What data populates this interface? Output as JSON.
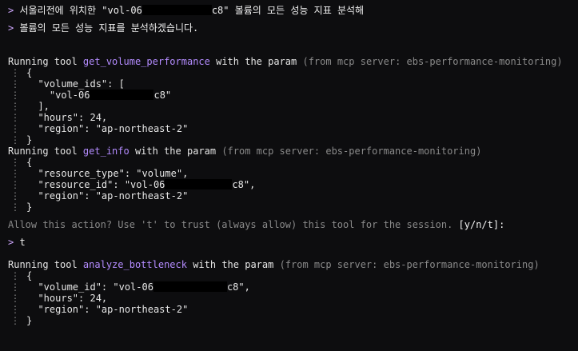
{
  "prompt_symbol": ">",
  "user_query": {
    "prefix": "서울리전에 위치한 \"vol-06",
    "suffix": "c8\" 볼륨의 모든 성능 지표 분석해"
  },
  "assistant_reply": "볼륨의 모든 성능 지표를 분석하겠습니다.",
  "running_prefix": "Running tool ",
  "param_word": " with the param ",
  "server_note": "(from mcp server: ebs-performance-monitoring)",
  "brace_open": "{",
  "brace_close": "}",
  "tool1": {
    "name": "get_volume_performance",
    "lines": {
      "volume_ids_open": "\"volume_ids\": [",
      "volume_id_prefix": "\"vol-06",
      "volume_id_suffix": "c8\"",
      "array_close": "],",
      "hours": "\"hours\": 24,",
      "region": "\"region\": \"ap-northeast-2\""
    }
  },
  "tool2": {
    "name": "get_info",
    "lines": {
      "resource_type": "\"resource_type\": \"volume\",",
      "resource_id_prefix": "\"resource_id\": \"vol-06",
      "resource_id_suffix": "c8\",",
      "region": "\"region\": \"ap-northeast-2\""
    }
  },
  "permission": {
    "text": "Allow this action? Use 't' to trust (always allow) this tool for the session. ",
    "options": "[y/n/t]:"
  },
  "user_answer": "t",
  "tool3": {
    "name": "analyze_bottleneck",
    "lines": {
      "volume_id_prefix": "\"volume_id\": \"vol-06",
      "volume_id_suffix": "c8\",",
      "hours": "\"hours\": 24,",
      "region": "\"region\": \"ap-northeast-2\""
    }
  },
  "guide_glyph": "⋮",
  "colors": {
    "background": "#0d0d0f",
    "text": "#e6e6e6",
    "tool_name": "#b48cff",
    "muted": "#8a8a8a",
    "prompt": "#cfa8ff"
  }
}
